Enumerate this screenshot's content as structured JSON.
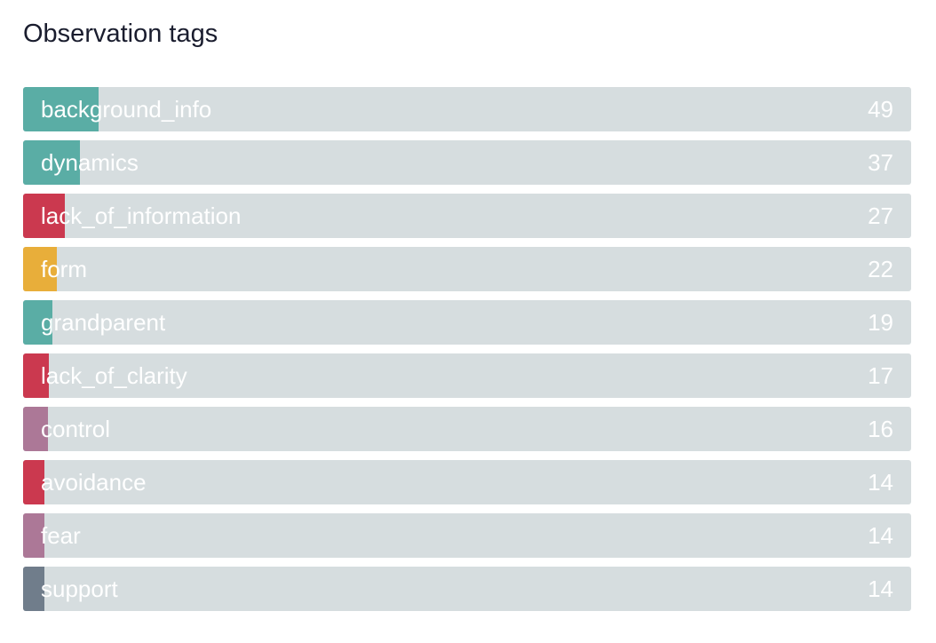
{
  "title": "Observation tags",
  "colors": {
    "teal": "#5aada5",
    "red": "#cb394f",
    "yellow": "#e8ae3a",
    "mauve": "#ac7897",
    "slate": "#707d8b",
    "track": "#d6dddf"
  },
  "chart_data": {
    "type": "bar",
    "orientation": "horizontal",
    "title": "Observation tags",
    "categories": [
      "background_info",
      "dynamics",
      "lack_of_information",
      "form",
      "grandparent",
      "lack_of_clarity",
      "control",
      "avoidance",
      "fear",
      "support"
    ],
    "values": [
      49,
      37,
      27,
      22,
      19,
      17,
      16,
      14,
      14,
      14
    ],
    "bar_colors": [
      "#5aada5",
      "#5aada5",
      "#cb394f",
      "#e8ae3a",
      "#5aada5",
      "#cb394f",
      "#ac7897",
      "#cb394f",
      "#ac7897",
      "#707d8b"
    ],
    "xlim": [
      0,
      578
    ],
    "grid": false,
    "legend": "none"
  }
}
